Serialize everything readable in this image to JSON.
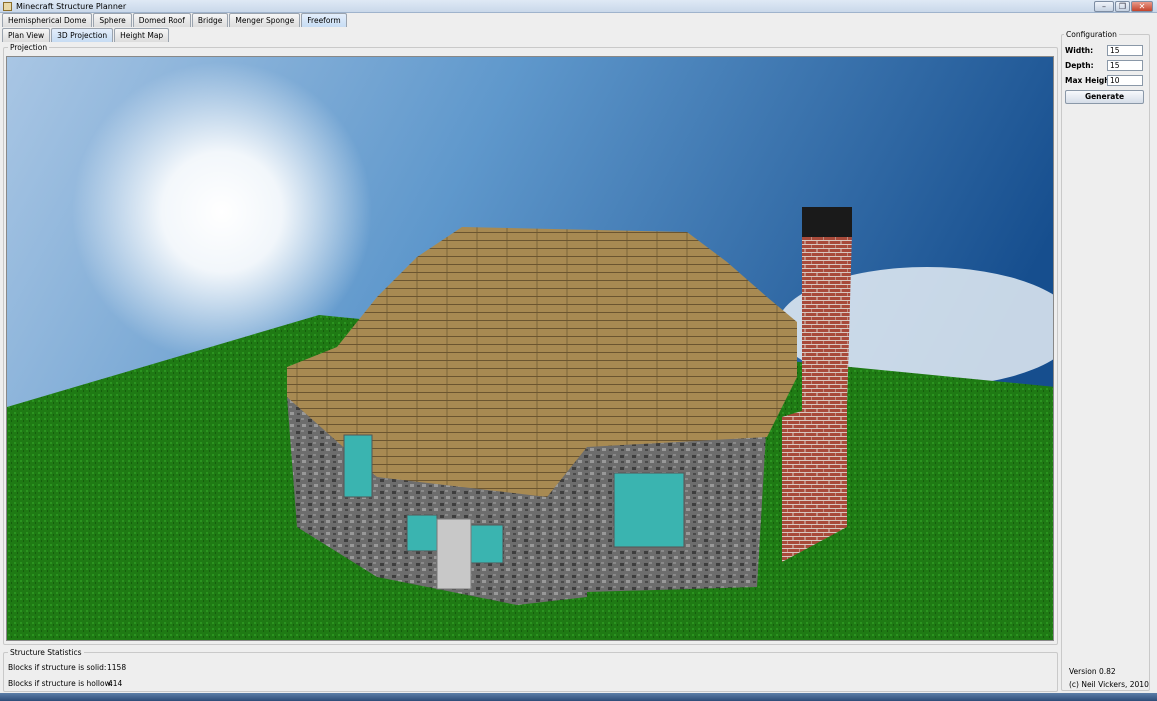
{
  "window": {
    "title": "Minecraft Structure Planner",
    "minimize": "–",
    "restore": "❐",
    "close": "✕"
  },
  "structure_tabs": [
    {
      "label": "Hemispherical Dome"
    },
    {
      "label": "Sphere"
    },
    {
      "label": "Domed Roof"
    },
    {
      "label": "Bridge"
    },
    {
      "label": "Menger Sponge"
    },
    {
      "label": "Freeform",
      "active": true
    }
  ],
  "view_tabs": [
    {
      "label": "Plan View"
    },
    {
      "label": "3D Projection",
      "active": true
    },
    {
      "label": "Height Map"
    }
  ],
  "projection": {
    "title": "Projection"
  },
  "configuration": {
    "title": "Configuration",
    "width_label": "Width:",
    "width_value": "15",
    "depth_label": "Depth:",
    "depth_value": "15",
    "max_height_label": "Max Height:",
    "max_height_value": "10",
    "generate_label": "Generate"
  },
  "statistics": {
    "title": "Structure Statistics",
    "solid_label": "Blocks if structure is solid:",
    "solid_value": "1158",
    "hollow_label": "Blocks if structure is hollow:",
    "hollow_value": "414"
  },
  "footer": {
    "version": "Version 0.82",
    "copyright": "(c) Neil Vickers, 2010"
  },
  "colors": {
    "sky_top": "#1d5a9a",
    "grass": "#1f7a14",
    "wood": "#a88a52",
    "stone": "#6a6a6a",
    "brick": "#a84a3a",
    "glass": "#3ab4b0"
  }
}
